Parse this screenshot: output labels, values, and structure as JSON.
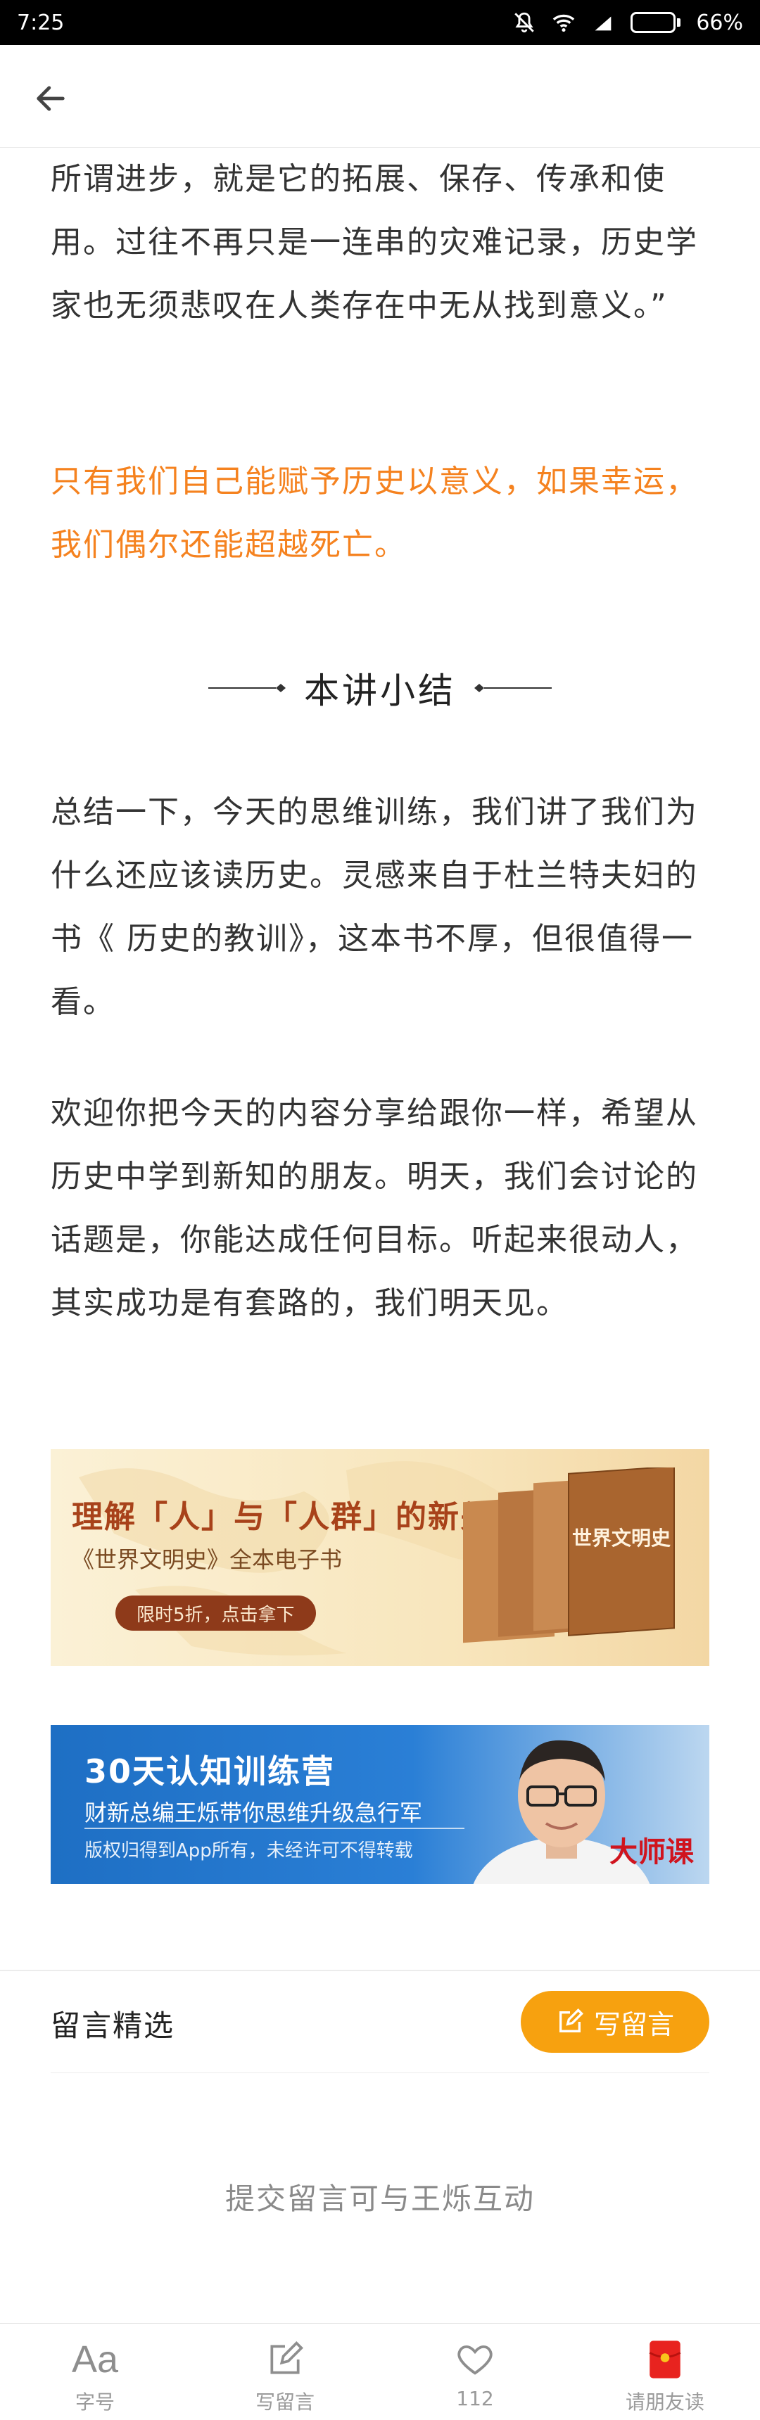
{
  "status_bar": {
    "time": "7:25",
    "battery": "66%",
    "battery_level": 0.66
  },
  "article": {
    "paragraph_1": "所谓进步，就是它的拓展、保存、传承和使用。过往不再只是一连串的灾难记录，历史学家也无须悲叹在人类存在中无从找到意义。”",
    "highlight": "只有我们自己能赋予历史以意义，如果幸运，我们偶尔还能超越死亡。",
    "section_title": "本讲小结",
    "paragraph_3": "总结一下，今天的思维训练，我们讲了我们为什么还应该读历史。灵感来自于杜兰特夫妇的书《 历史的教训》，这本书不厚，但很值得一看。",
    "paragraph_4": "欢迎你把今天的内容分享给跟你一样，希望从历史中学到新知的朋友。明天，我们会讨论的话题是，你能达成任何目标。听起来很动人，其实成功是有套路的，我们明天见。"
  },
  "banner_book": {
    "headline": "理解「人」与「人群」的新关系",
    "subline": "《世界文明史》全本电子书",
    "cta": "限时5折，点击拿下",
    "book_title": "世界文明史"
  },
  "banner_camp": {
    "headline": "30天认知训练营",
    "subline": "财新总编王烁带你思维升级急行军",
    "note": "版权归得到App所有，未经许可不得转载",
    "brand": "大师课"
  },
  "comments": {
    "title": "留言精选",
    "write_button": "写留言",
    "empty_hint": "提交留言可与王烁互动"
  },
  "tabbar": {
    "font_icon": "Aa",
    "tabs": [
      {
        "label": "字号",
        "icon": "font-size-icon"
      },
      {
        "label": "写留言",
        "icon": "edit-icon"
      },
      {
        "label": "112",
        "icon": "heart-icon"
      },
      {
        "label": "请朋友读",
        "icon": "red-envelope-icon"
      }
    ]
  },
  "colors": {
    "highlight": "#f5821f",
    "write_button": "#f7a10f",
    "banner_blue": "#1e6fc4",
    "brand_red": "#d0141e"
  }
}
